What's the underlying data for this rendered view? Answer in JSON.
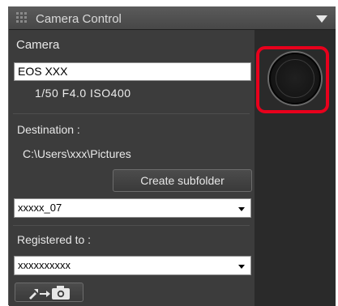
{
  "window": {
    "title": "Camera Control"
  },
  "camera": {
    "label": "Camera",
    "model_value": "EOS XXX",
    "settings": "1/50  F4.0  ISO400"
  },
  "destination": {
    "label": "Destination :",
    "path": "C:\\Users\\xxx\\Pictures",
    "create_subfolder_label": "Create subfolder",
    "subfolder_selected": "xxxxx_07"
  },
  "registered": {
    "label": "Registered to :",
    "selected": "xxxxxxxxxx"
  },
  "icons": {
    "grip": "grip-icon",
    "collapse": "chevron-down-icon",
    "shutter": "shutter-button-icon",
    "transfer": "transfer-to-camera-icon"
  },
  "colors": {
    "highlight": "#e8001c",
    "panel_bg": "#3c3c3c",
    "titlebar_bg": "#4f4f4f"
  }
}
